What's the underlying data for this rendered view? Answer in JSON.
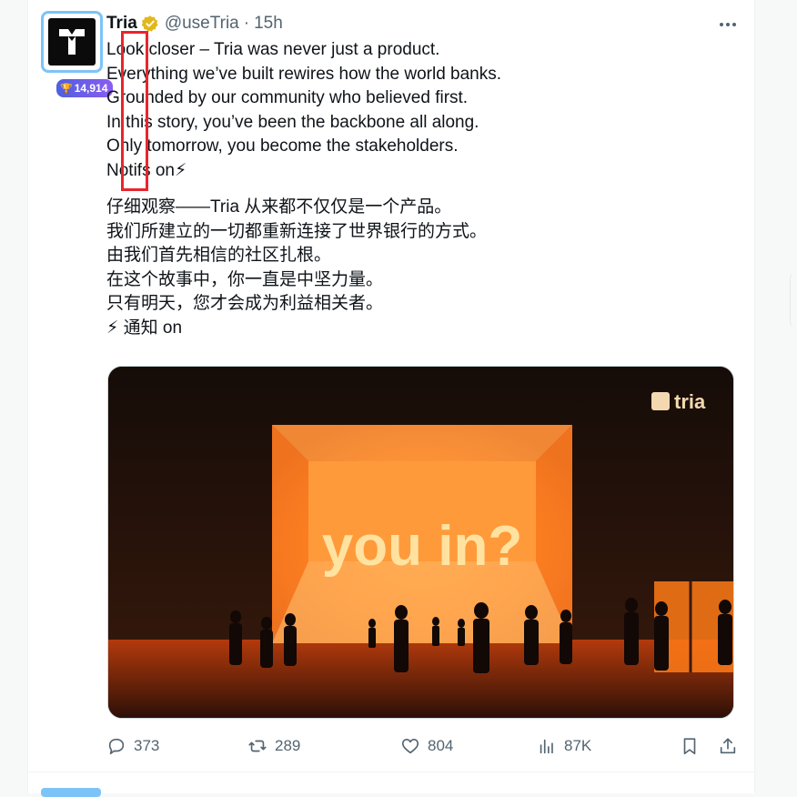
{
  "tweet": {
    "author_name": "Tria",
    "handle": "@useTria",
    "separator": "·",
    "time": "15h",
    "score_badge": "14,914",
    "more_icon": "more-horizontal-icon",
    "text_lines_en": [
      "Look closer – Tria was never just a product.",
      "Everything we’ve built rewires how the world banks.",
      "Grounded by our community who believed first.",
      "In this story, you’ve been the backbone all along.",
      "Only tomorrow, you become the stakeholders.",
      "Notifs on⚡"
    ],
    "text_lines_zh": [
      "仔细观察——Tria 从来都不仅仅是一个产品。",
      "我们所建立的一切都重新连接了世界银行的方式。",
      "由我们首先相信的社区扎根。",
      "在这个故事中，你一直是中坚力量。",
      "只有明天，您才会成为利益相关者。",
      "⚡ 通知 on"
    ],
    "media": {
      "brand_label": "tria",
      "headline": "you in?"
    },
    "actions": {
      "replies": "373",
      "reposts": "289",
      "likes": "804",
      "views": "87K"
    }
  },
  "colors": {
    "accent": "#1d9bf0",
    "verified_gold": "#e2b719",
    "highlight_red": "#e8262c",
    "muted": "#536471"
  }
}
